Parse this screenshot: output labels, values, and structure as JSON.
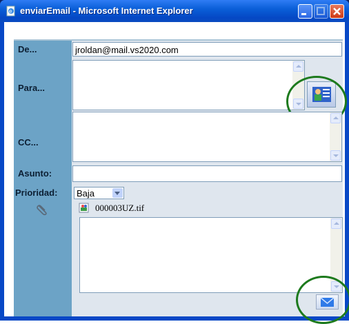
{
  "window": {
    "title": "enviarEmail - Microsoft Internet Explorer"
  },
  "form": {
    "de_label": "De...",
    "de_value": "jroldan@mail.vs2020.com",
    "para_label": "Para...",
    "cc_label": "CC...",
    "asunto_label": "Asunto:",
    "asunto_value": "",
    "prioridad_label": "Prioridad:",
    "prioridad_selected": "Baja",
    "attachment_name": "000003UZ.tif"
  },
  "icons": {
    "title_icon": "ie-page-icon",
    "address_book": "address-book-icon",
    "attach": "paperclip-icon",
    "file": "image-file-icon",
    "send": "envelope-send-icon"
  },
  "colors": {
    "label_column": "#6ca3c6",
    "highlight_circle": "#1d7a1d",
    "title_bar": "#0a5fd8"
  }
}
